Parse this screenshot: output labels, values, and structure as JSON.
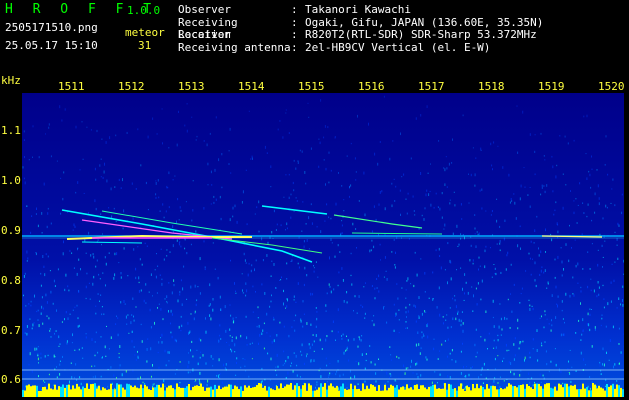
{
  "header": {
    "app_name": "H R O F F T",
    "app_version": "1.0.0",
    "filename": "2505171510.png",
    "datetime": "25.05.17 15:10",
    "counter_label": "meteor",
    "counter_value": "31"
  },
  "station": {
    "rows": [
      {
        "key": "Observer",
        "sep": ":",
        "value": "Takanori Kawachi"
      },
      {
        "key": "Receiving Location",
        "sep": ":",
        "value": "Ogaki, Gifu, JAPAN (136.60E, 35.35N)"
      },
      {
        "key": "Receiver",
        "sep": ":",
        "value": "R820T2(RTL-SDR) SDR-Sharp 53.372MHz"
      },
      {
        "key": "Receiving antenna",
        "sep": ":",
        "value": "2el-HB9CV Vertical (el. E-W)"
      }
    ]
  },
  "axes": {
    "unit_label": "kHz",
    "x_ticks": [
      "1511",
      "1512",
      "1513",
      "1514",
      "1515",
      "1516",
      "1517",
      "1518",
      "1519",
      "1520"
    ],
    "y_ticks": [
      "1.1",
      "1.0",
      "0.9",
      "0.8",
      "0.7",
      "0.6"
    ]
  },
  "colors": {
    "background": "#000000",
    "plot_background": "#00008a",
    "title_green": "#00ff00",
    "tick_yellow": "#ffff40",
    "trace_cyan": "#00ffff",
    "trace_hot": "#ff40ff"
  }
}
